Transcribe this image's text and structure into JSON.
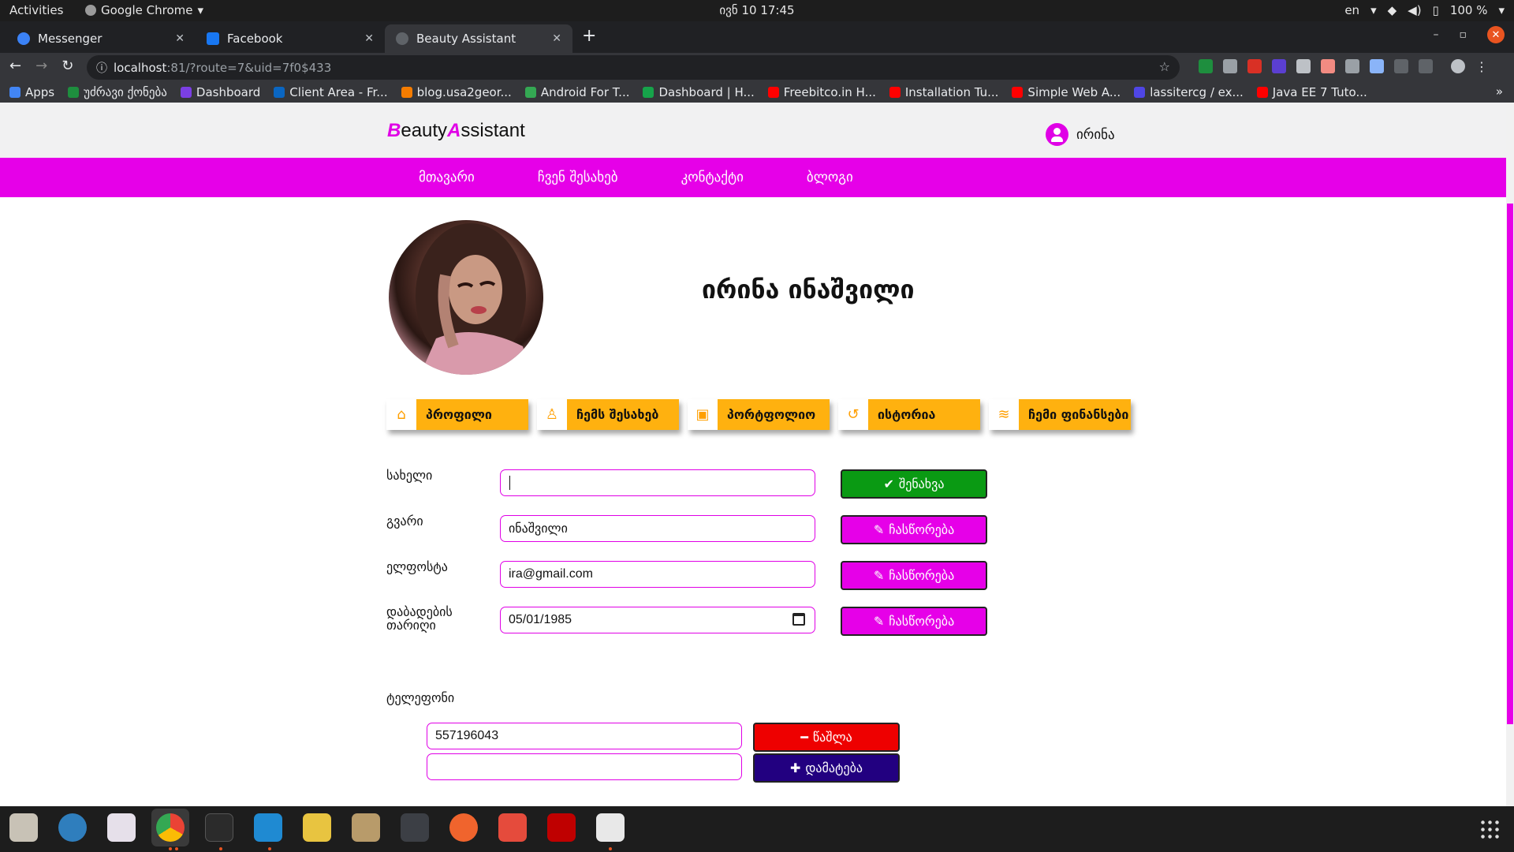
{
  "system": {
    "activities": "Activities",
    "app_name": "Google Chrome",
    "clock": "ივნ 10  17:45",
    "lang": "en",
    "battery": "100 %"
  },
  "browser": {
    "tabs": [
      {
        "title": "Messenger",
        "favicon_color": "#3b82f6"
      },
      {
        "title": "Facebook",
        "favicon_color": "#1877f2"
      },
      {
        "title": "Beauty Assistant",
        "favicon_color": "#5f6368"
      }
    ],
    "url_host": "localhost",
    "url_path": ":81/?route=7&uid=7f0$433",
    "bookmarks": [
      {
        "label": "Apps",
        "color": "#4285f4"
      },
      {
        "label": "უძრავი ქონება",
        "color": "#1e8e3e"
      },
      {
        "label": "Dashboard",
        "color": "#7b3fe4"
      },
      {
        "label": "Client Area - Fr...",
        "color": "#0a66c2"
      },
      {
        "label": "blog.usa2geor...",
        "color": "#f57c00"
      },
      {
        "label": "Android For T...",
        "color": "#34a853"
      },
      {
        "label": "Dashboard | H...",
        "color": "#16a34a"
      },
      {
        "label": "Freebitco.in H...",
        "color": "#ff0000"
      },
      {
        "label": "Installation Tu...",
        "color": "#ff0000"
      },
      {
        "label": "Simple Web A...",
        "color": "#ff0000"
      },
      {
        "label": "lassitercg / ex...",
        "color": "#4f46e5"
      },
      {
        "label": "Java EE 7 Tuto...",
        "color": "#ff0000"
      }
    ],
    "bookmarks_more": "»"
  },
  "site": {
    "logo_b": "B",
    "logo_eauty": "eauty",
    "logo_a": "A",
    "logo_ssistant": "ssistant",
    "user_name": "ირინა",
    "nav": [
      "მთავარი",
      "ჩვენ შესახებ",
      "კონტაქტი",
      "ბლოგი"
    ],
    "full_name": "ირინა ინაშვილი",
    "profile_tabs": [
      {
        "label": "პროფილი",
        "icon": "home-icon"
      },
      {
        "label": "ჩემს შესახებ",
        "icon": "user-icon"
      },
      {
        "label": "პორტფოლიო",
        "icon": "images-icon"
      },
      {
        "label": "ისტორია",
        "icon": "history-icon"
      },
      {
        "label": "ჩემი ფინანსები",
        "icon": "coins-icon"
      }
    ],
    "form": {
      "first_name_label": "სახელი",
      "first_name_value": "",
      "last_name_label": "გვარი",
      "last_name_value": "ინაშვილი",
      "email_label": "ელფოსტა",
      "email_value": "ira@gmail.com",
      "birth_label": "დაბადების თარიღი",
      "birth_value": "05/01/1985",
      "save_label": "შენახვა",
      "edit_label": "ჩასწორება",
      "phone_label": "ტელეფონი",
      "phone_1_value": "557196043",
      "phone_2_value": "",
      "delete_label": "წაშლა",
      "add_label": "დამატება"
    }
  },
  "colors": {
    "brand": "#e600e8",
    "tab_bg": "#ffb10f",
    "save": "#0a9a13",
    "delete": "#ee0000",
    "add": "#220080"
  }
}
